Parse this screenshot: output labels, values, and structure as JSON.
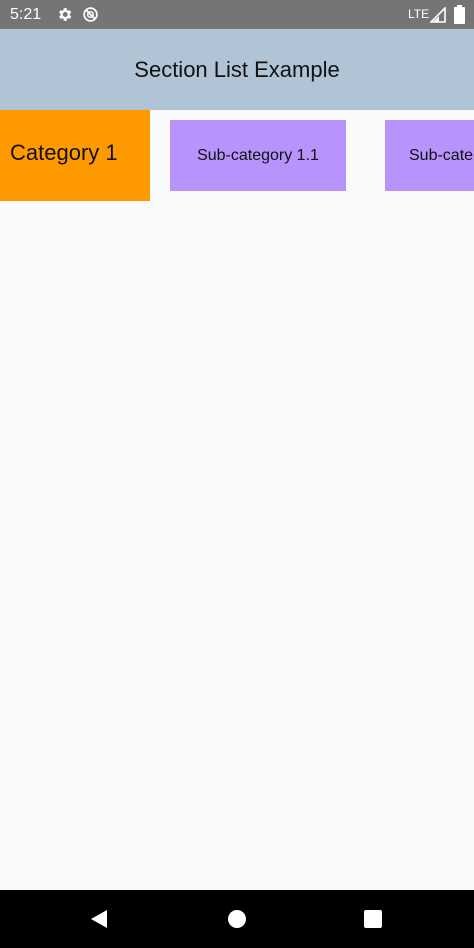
{
  "status_bar": {
    "time": "5:21",
    "network": "LTE",
    "icons": [
      "settings-icon",
      "do-not-disturb-icon",
      "signal-icon",
      "battery-icon"
    ]
  },
  "app_bar": {
    "title": "Section List Example",
    "background": "#b0c4d6"
  },
  "sections": [
    {
      "category": "Category 1",
      "category_color": "#ff9900",
      "subcategories": [
        "Sub-category 1.1",
        "Sub-cate"
      ],
      "subcategory_color": "#b694fb"
    }
  ],
  "nav_bar": {
    "icons": [
      "back-icon",
      "home-icon",
      "recents-icon"
    ]
  }
}
